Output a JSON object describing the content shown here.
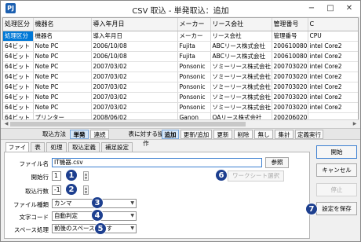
{
  "window": {
    "app_icon": "PJ",
    "title": "CSV 取込 - 単発取込：追加",
    "minimize": "−",
    "maximize": "□",
    "close": "✕"
  },
  "grid": {
    "headers": [
      "処理区分",
      "機器名",
      "導入年月日",
      "メーカー",
      "リース会社",
      "管理番号",
      "C"
    ],
    "rows": [
      [
        "処理区分",
        "機器名",
        "導入年月日",
        "メーカー",
        "リース会社",
        "管理番号",
        "CPU"
      ],
      [
        "64ビット",
        "Note PC",
        "2006/10/08",
        "Fujita",
        "ABCリース株式会社",
        "2006100801",
        "intel Core2"
      ],
      [
        "64ビット",
        "Note PC",
        "2006/10/08",
        "Fujita",
        "ABCリース株式会社",
        "2006100802",
        "intel Core2"
      ],
      [
        "64ビット",
        "Note PC",
        "2007/03/02",
        "Ponsonic",
        "ソミーリース株式会社",
        "2007030201",
        "intel Core2"
      ],
      [
        "64ビット",
        "Note PC",
        "2007/03/02",
        "Ponsonic",
        "ソミーリース株式会社",
        "2007030202",
        "intel Core2"
      ],
      [
        "64ビット",
        "Note PC",
        "2007/03/02",
        "Ponsonic",
        "ソミーリース株式会社",
        "2007030203",
        "intel Core2"
      ],
      [
        "64ビット",
        "Note PC",
        "2007/03/02",
        "Ponsonic",
        "ソミーリース株式会社",
        "2007030204",
        "intel Core2"
      ],
      [
        "64ビット",
        "Note PC",
        "2007/03/02",
        "Ponsonic",
        "ソミーリース株式会社",
        "2007030205",
        "intel Core2"
      ],
      [
        "64ビット",
        "プリンター",
        "2008/06/02",
        "Ganon",
        "OAリース株式会社",
        "200206020",
        ""
      ]
    ]
  },
  "toolbar": {
    "import_method_label": "取込方法",
    "single": "単発",
    "continuous": "連続",
    "table_op_label": "表に対する操作",
    "add": "追加",
    "update_add": "更新/追加",
    "update": "更新",
    "delete": "削除",
    "none": "無し",
    "aggregate": "集計",
    "scheduled": "定義実行"
  },
  "tabs": [
    "ファイル",
    "表",
    "処理",
    "取込定義",
    "補足設定"
  ],
  "form": {
    "filename_label": "ファイル名",
    "filename_value": "IT機器.csv",
    "browse_button": "参照",
    "worksheet_button": "ワークシート選択",
    "start_row_label": "開始行",
    "start_row_value": "1",
    "row_count_label": "取込行数",
    "row_count_value": "-1",
    "file_type_label": "ファイル種類",
    "file_type_value": "カンマ",
    "encoding_label": "文字コード",
    "encoding_value": "自動判定",
    "space_label": "スペース処理",
    "space_value": "前後のスペースを消す"
  },
  "side_buttons": {
    "start": "開始",
    "cancel": "キャンセル",
    "stop": "停止",
    "save_settings": "設定を保存"
  },
  "badges": [
    "1",
    "2",
    "3",
    "4",
    "5",
    "6",
    "7"
  ]
}
